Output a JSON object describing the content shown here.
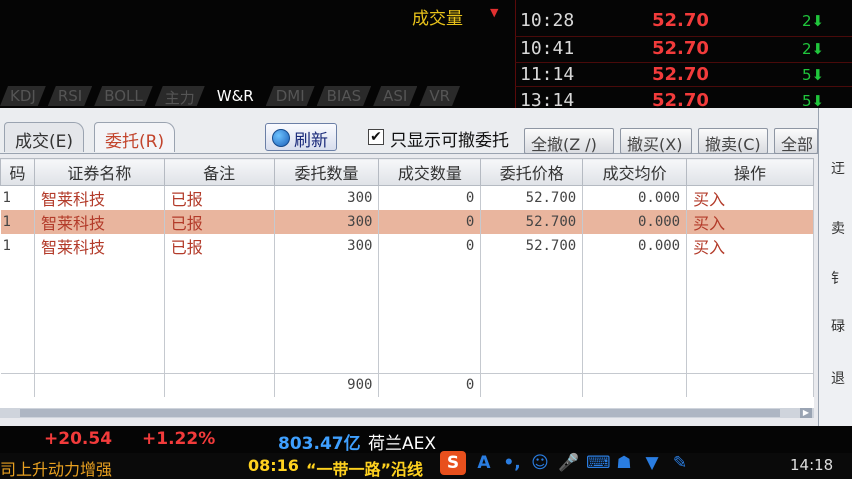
{
  "market": {
    "volume_label": "成交量",
    "ticks": [
      {
        "time": "10:28",
        "price": "52.70",
        "qty": "2"
      },
      {
        "time": "10:41",
        "price": "52.70",
        "qty": "2"
      },
      {
        "time": "11:14",
        "price": "52.70",
        "qty": "5"
      },
      {
        "time": "13:14",
        "price": "52.70",
        "qty": "5"
      }
    ],
    "indicator_tabs": [
      "KDJ",
      "RSI",
      "BOLL",
      "主力",
      "W&R",
      "DMI",
      "BIAS",
      "ASI",
      "VR"
    ],
    "active_indicator": "W&R"
  },
  "panel": {
    "tabs": [
      {
        "label": "成交(E)"
      },
      {
        "label": "委托(R)"
      }
    ],
    "refresh_label": "刷新",
    "only_cancellable_label": "只显示可撤委托",
    "only_cancellable_checked": "✔",
    "buttons": [
      "全撤(Z /)",
      "撤买(X)",
      "撤卖(C)",
      "全部"
    ],
    "columns": [
      "码",
      "证券名称",
      "备注",
      "委托数量",
      "成交数量",
      "委托价格",
      "成交均价",
      "操作"
    ],
    "rows": [
      {
        "code": "1",
        "name": "智莱科技",
        "note": "已报",
        "order_qty": "300",
        "filled_qty": "0",
        "order_price": "52.700",
        "avg_price": "0.000",
        "action": "买入"
      },
      {
        "code": "1",
        "name": "智莱科技",
        "note": "已报",
        "order_qty": "300",
        "filled_qty": "0",
        "order_price": "52.700",
        "avg_price": "0.000",
        "action": "买入"
      },
      {
        "code": "1",
        "name": "智莱科技",
        "note": "已报",
        "order_qty": "300",
        "filled_qty": "0",
        "order_price": "52.700",
        "avg_price": "0.000",
        "action": "买入"
      }
    ],
    "totals": {
      "order_qty": "900",
      "filled_qty": "0"
    }
  },
  "right_edge": {
    "chars": [
      "迂",
      "卖",
      "钅",
      "碌",
      "退"
    ]
  },
  "status": {
    "change_abs": "+20.54",
    "change_pct": "+1.22%",
    "turnover": "803.47亿",
    "index_name": "荷兰AEX",
    "ticker_left": "司上升动力增强",
    "news_time": "08:16",
    "news_text": "“一带一路”沿线",
    "clock": "14:18"
  },
  "colors": {
    "up": "#f23b3b",
    "down": "#20c63c",
    "accent": "#c2442c",
    "selected_row": "#e9b59e"
  }
}
